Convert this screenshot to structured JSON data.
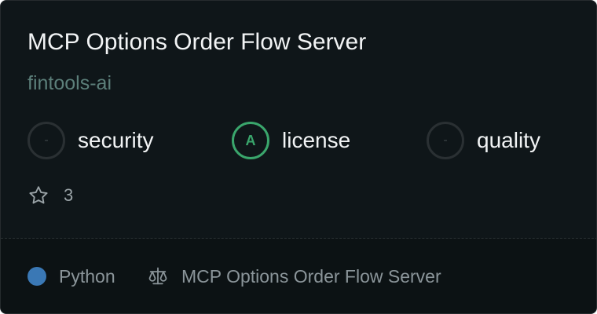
{
  "card": {
    "title": "MCP Options Order Flow Server",
    "owner": "fintools-ai"
  },
  "metrics": [
    {
      "grade": "-",
      "label": "security",
      "status": "unrated"
    },
    {
      "grade": "A",
      "label": "license",
      "status": "good"
    },
    {
      "grade": "-",
      "label": "quality",
      "status": "unrated"
    }
  ],
  "stars": {
    "icon": "star-icon",
    "count": "3"
  },
  "footer": {
    "language": "Python",
    "language_color": "#3a78b5",
    "license_icon": "scale-icon",
    "license_text": "MCP Options Order Flow Server"
  },
  "colors": {
    "background": "#0f1619",
    "grade_good": "#3aa66c",
    "owner_text": "#5c7f7a"
  }
}
